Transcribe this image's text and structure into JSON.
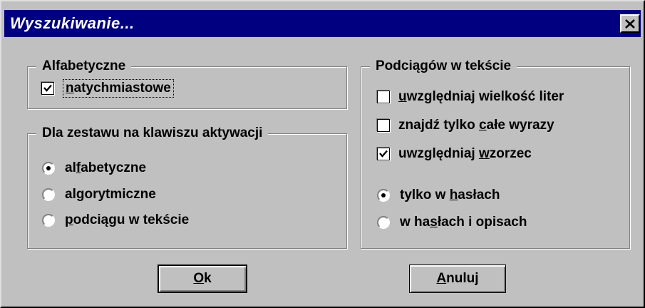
{
  "dialog": {
    "title": "Wyszukiwanie...",
    "close_icon": "close-icon"
  },
  "alfabetyczne_group": {
    "legend": "Alfabetyczne",
    "option": {
      "pre": "",
      "accel": "n",
      "post": "atychmiastowe",
      "checked": true
    }
  },
  "zestaw_group": {
    "legend": "Dla zestawu na klawiszu aktywacji",
    "options": [
      {
        "pre": "al",
        "accel": "f",
        "post": "abetyczne",
        "selected": true
      },
      {
        "pre": "al",
        "accel": "g",
        "post": "orytmiczne",
        "selected": false
      },
      {
        "pre": "",
        "accel": "p",
        "post": "odciągu w tekście",
        "selected": false
      }
    ]
  },
  "podciagow_group": {
    "legend": "Podciągów w tekście",
    "checkboxes": [
      {
        "pre": "",
        "accel": "u",
        "post": "względniaj wielkość liter",
        "checked": false
      },
      {
        "pre": "znajdź tylko ",
        "accel": "c",
        "post": "ałe wyrazy",
        "checked": false
      },
      {
        "pre": "uwzględniaj ",
        "accel": "w",
        "post": "zorzec",
        "checked": true
      }
    ],
    "radios": [
      {
        "pre": "tylko w ",
        "accel": "h",
        "post": "asłach",
        "selected": true
      },
      {
        "pre": "w ha",
        "accel": "s",
        "post": "łach i opisach",
        "selected": false
      }
    ]
  },
  "buttons": {
    "ok": {
      "pre": "",
      "accel": "O",
      "post": "k"
    },
    "cancel": {
      "pre": "",
      "accel": "A",
      "post": "nuluj"
    }
  },
  "colors": {
    "titlebar": "#000080",
    "face": "#c0c0c0"
  }
}
